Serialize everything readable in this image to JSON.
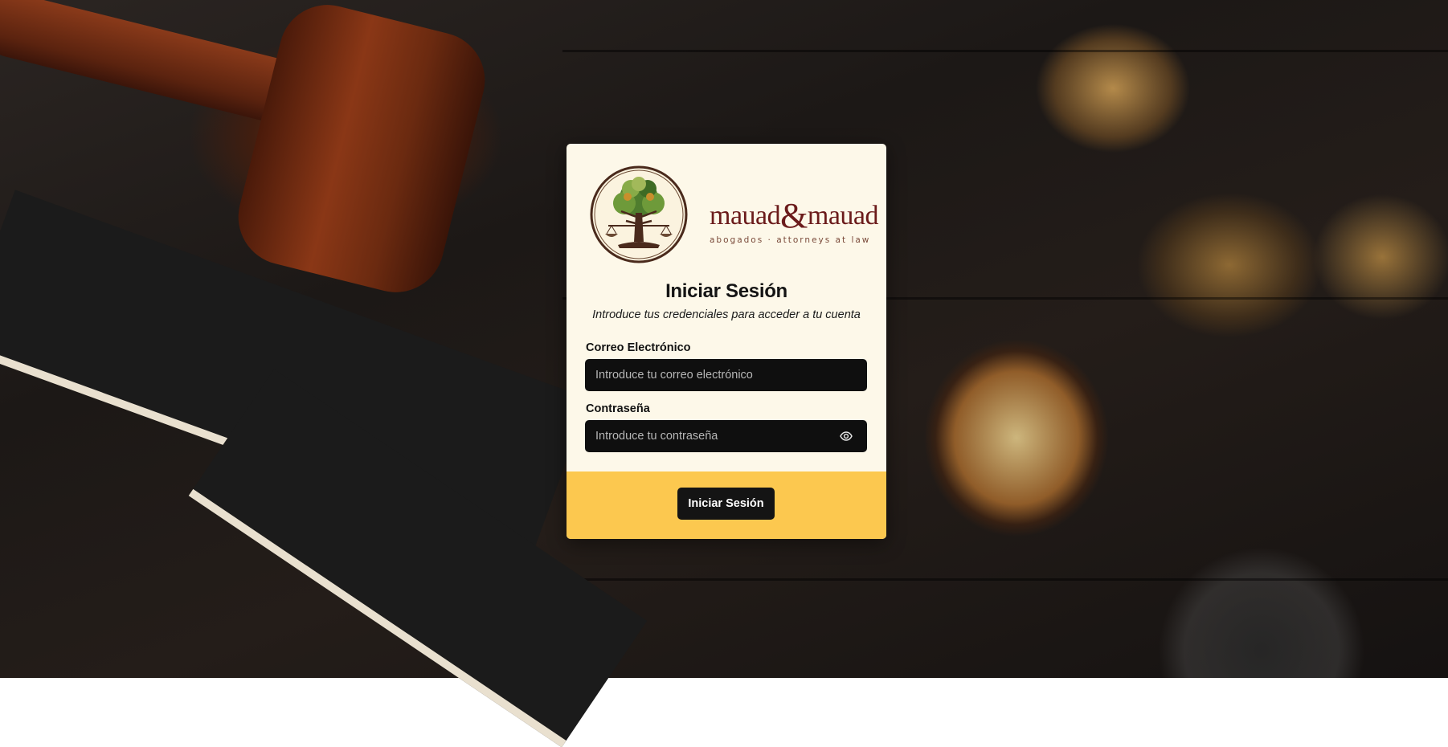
{
  "brand": {
    "name_left": "mauad",
    "ampersand": "&",
    "name_right": "mauad",
    "tagline": "abogados · attorneys at law",
    "emblem_icon": "tree-scales-emblem-icon"
  },
  "login": {
    "title": "Iniciar Sesión",
    "subtitle": "Introduce tus credenciales para acceder a tu cuenta",
    "email": {
      "label": "Correo Electrónico",
      "value": "",
      "placeholder": "Introduce tu correo electrónico"
    },
    "password": {
      "label": "Contraseña",
      "value": "",
      "placeholder": "Introduce tu contraseña",
      "toggle_icon": "eye-icon"
    },
    "submit_label": "Iniciar Sesión"
  },
  "colors": {
    "card_background": "#fdf8e9",
    "footer_accent": "#fcc84f",
    "input_background": "#0f0f0f",
    "brand_red": "#6b1b1b",
    "button_background": "#141414"
  }
}
